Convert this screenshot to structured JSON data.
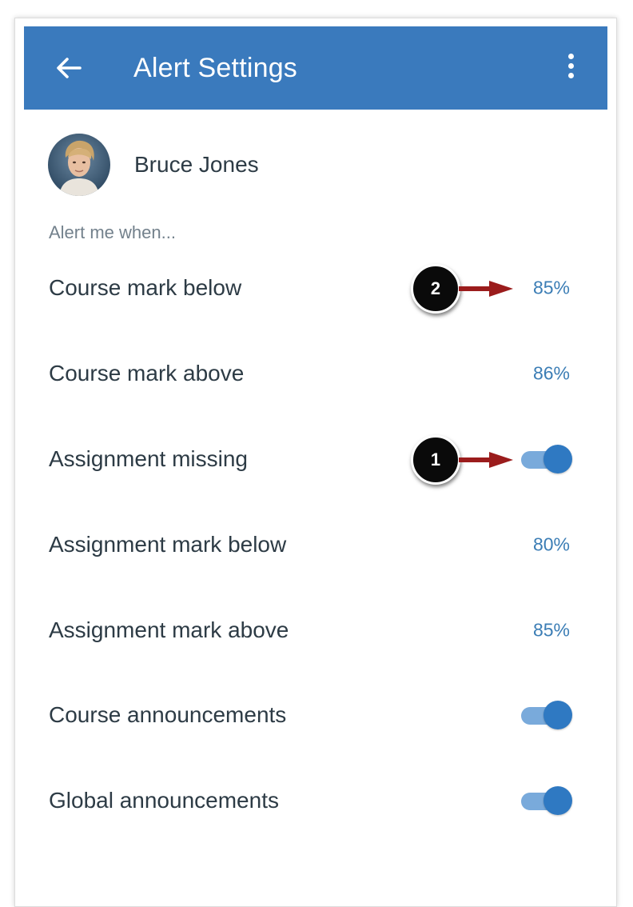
{
  "header": {
    "title": "Alert Settings",
    "back_icon": "arrow-left-icon",
    "menu_icon": "more-vertical-icon",
    "background_color": "#3a7abd"
  },
  "student": {
    "name": "Bruce Jones"
  },
  "section": {
    "label": "Alert me when..."
  },
  "alerts": [
    {
      "label": "Course mark below",
      "type": "value",
      "value": "85%"
    },
    {
      "label": "Course mark above",
      "type": "value",
      "value": "86%"
    },
    {
      "label": "Assignment missing",
      "type": "toggle",
      "on": true
    },
    {
      "label": "Assignment mark below",
      "type": "value",
      "value": "80%"
    },
    {
      "label": "Assignment mark above",
      "type": "value",
      "value": "85%"
    },
    {
      "label": "Course announcements",
      "type": "toggle",
      "on": true
    },
    {
      "label": "Global announcements",
      "type": "toggle",
      "on": true
    }
  ],
  "callouts": [
    {
      "number": "1",
      "target": "Assignment missing toggle"
    },
    {
      "number": "2",
      "target": "Course mark below value"
    }
  ],
  "colors": {
    "accent": "#3b7db5",
    "toggle_thumb": "#2f79c2",
    "toggle_track": "#79aadb",
    "callout_arrow": "#9b1c1c"
  }
}
